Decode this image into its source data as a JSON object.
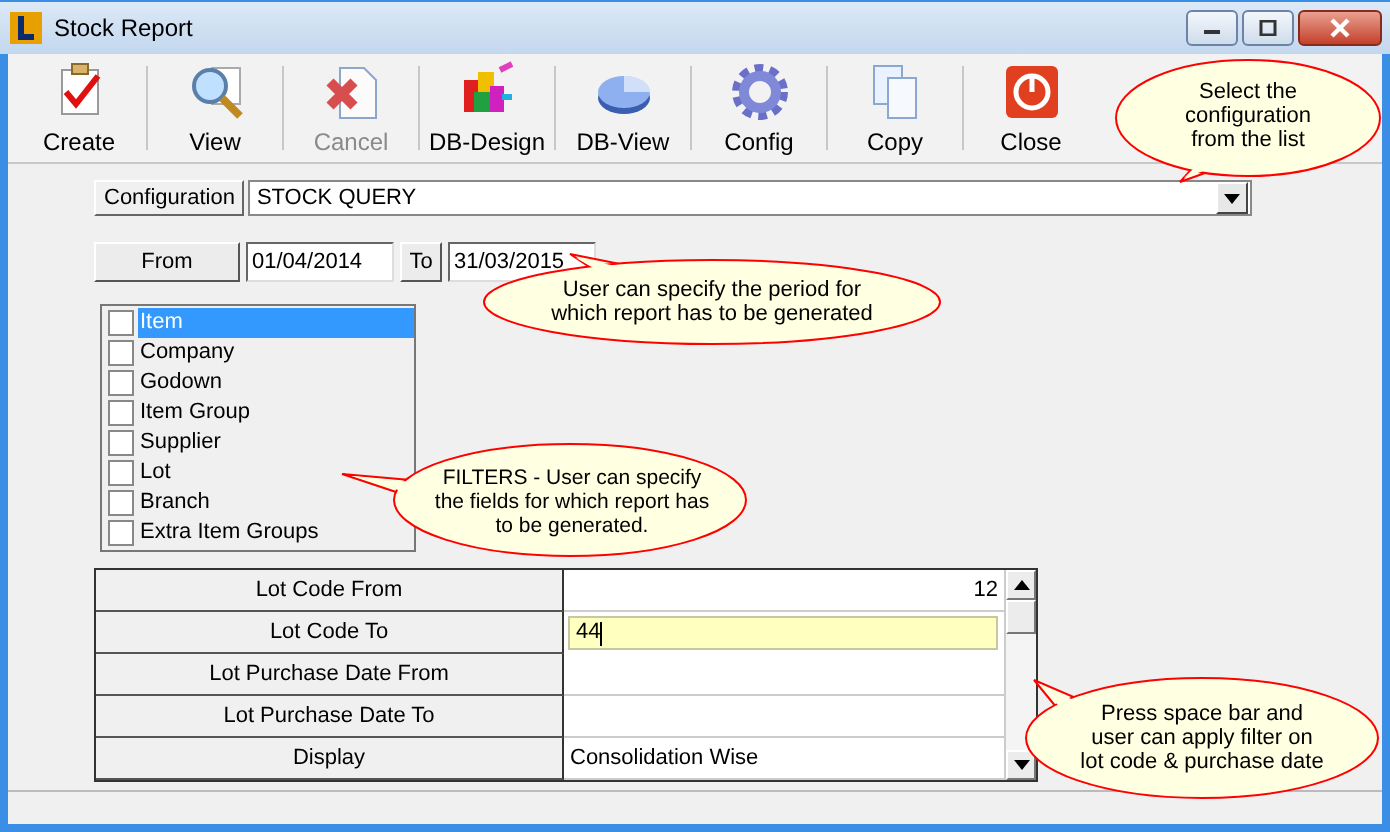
{
  "window": {
    "title": "Stock Report"
  },
  "toolbar": [
    {
      "label": "Create",
      "kind": "create",
      "disabled": false
    },
    {
      "label": "View",
      "kind": "view",
      "disabled": false
    },
    {
      "label": "Cancel",
      "kind": "cancel",
      "disabled": true
    },
    {
      "label": "DB-Design",
      "kind": "dbdesign",
      "disabled": false
    },
    {
      "label": "DB-View",
      "kind": "dbview",
      "disabled": false
    },
    {
      "label": "Config",
      "kind": "config",
      "disabled": false
    },
    {
      "label": "Copy",
      "kind": "copy",
      "disabled": false
    },
    {
      "label": "Close",
      "kind": "close",
      "disabled": false
    }
  ],
  "configuration": {
    "label": "Configuration",
    "value": "STOCK QUERY"
  },
  "period": {
    "from_label": "From",
    "from": "01/04/2014",
    "to_label": "To",
    "to": "31/03/2015"
  },
  "filters": [
    {
      "label": "Item",
      "checked": false,
      "selected": true
    },
    {
      "label": "Company",
      "checked": false,
      "selected": false
    },
    {
      "label": "Godown",
      "checked": false,
      "selected": false
    },
    {
      "label": "Item Group",
      "checked": false,
      "selected": false
    },
    {
      "label": "Supplier",
      "checked": false,
      "selected": false
    },
    {
      "label": "Lot",
      "checked": false,
      "selected": false
    },
    {
      "label": "Branch",
      "checked": false,
      "selected": false
    },
    {
      "label": "Extra Item Groups",
      "checked": false,
      "selected": false
    }
  ],
  "grid": [
    {
      "label": "Lot Code From",
      "value": "12",
      "kind": "number",
      "focused": false
    },
    {
      "label": "Lot Code To",
      "value": "44",
      "kind": "text",
      "focused": true
    },
    {
      "label": "Lot Purchase Date From",
      "kind": "text",
      "focused": false
    },
    {
      "label": "Lot Purchase Date To",
      "kind": "text",
      "focused": false
    },
    {
      "label": "Display",
      "value": "Consolidation Wise",
      "kind": "text",
      "focused": false
    }
  ],
  "callouts": [
    {
      "text": "Select the configuration from the list"
    },
    {
      "text": "User can specify the period for which report has to be generated"
    },
    {
      "text": "FILTERS - User can specify the fields for which report has to be generated."
    },
    {
      "text": "Press space bar and user can apply filter on lot code & purchase date"
    }
  ]
}
